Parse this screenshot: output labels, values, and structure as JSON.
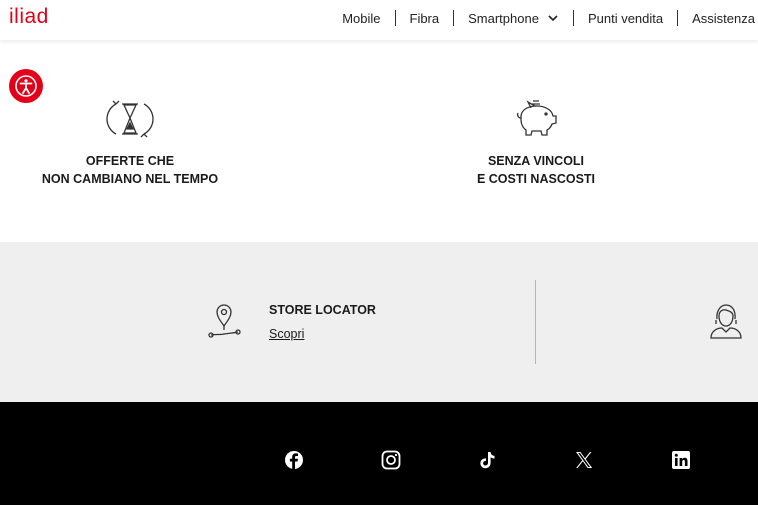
{
  "header": {
    "logo": "iliad",
    "nav": [
      {
        "label": "Mobile"
      },
      {
        "label": "Fibra"
      },
      {
        "label": "Smartphone"
      },
      {
        "label": "Punti vendita"
      },
      {
        "label": "Assistenza"
      }
    ]
  },
  "features": [
    {
      "icon": "hourglass-icon",
      "line1": "OFFERTE CHE",
      "line2": "NON CAMBIANO NEL TEMPO"
    },
    {
      "icon": "piggy-bank-icon",
      "line1": "SENZA VINCOLI",
      "line2": "E COSTI NASCOSTI"
    }
  ],
  "store": {
    "icon": "map-pin-icon",
    "title": "STORE LOCATOR",
    "link": "Scopri"
  },
  "support": {
    "icon": "support-agent-icon"
  },
  "footer": {
    "social": [
      "facebook-icon",
      "instagram-icon",
      "tiktok-icon",
      "x-icon",
      "linkedin-icon"
    ]
  },
  "accessibility": {
    "icon": "accessibility-icon"
  },
  "colors": {
    "brand": "#e2001a",
    "grey_bg": "#efefef",
    "footer_bg": "#000000"
  }
}
